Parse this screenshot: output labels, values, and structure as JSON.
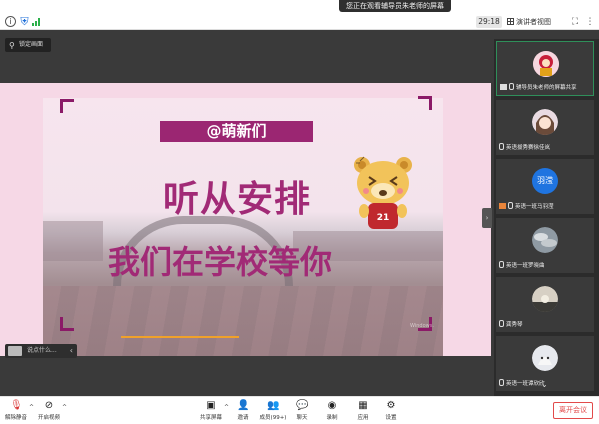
{
  "topbar": {
    "viewing_banner": "您正在观看辅导员朱老师的屏幕",
    "timer": "29:18",
    "view_mode": "演讲者视图"
  },
  "lock_badge": "锁定画面",
  "slide": {
    "tag": "@萌新们",
    "line1": "听从安排",
    "line2": "我们在学校等你",
    "watermark": "Windows.",
    "bear_number": "21"
  },
  "chat_preview": "说点什么...",
  "participants": [
    {
      "name": "辅导员朱老师的屏幕共享",
      "avatar": "cartoon-red",
      "active": true
    },
    {
      "name": "英语拔秀赛徐佳岚",
      "avatar": "anime-girl"
    },
    {
      "name": "英语一班马羽滢",
      "avatar": "text-badge",
      "badge": "羽滢"
    },
    {
      "name": "英语一班罗晓曲",
      "avatar": "sky"
    },
    {
      "name": "龚秀琴",
      "avatar": "dusk"
    },
    {
      "name": "英语一班谭欣欣",
      "avatar": "cat"
    }
  ],
  "toolbar": {
    "unmute": "解除静音",
    "start_video": "开启视频",
    "share_screen": "共享屏幕",
    "invite": "邀请",
    "members": "成员(99+)",
    "chat": "聊天",
    "record": "录制",
    "apps": "应用",
    "settings": "设置",
    "leave": "离开会议"
  },
  "colors": {
    "accent_magenta": "#9b2672",
    "leave_red": "#e24a4a",
    "active_green": "#2f8f5a",
    "avatar_blue": "#1f74e0"
  }
}
